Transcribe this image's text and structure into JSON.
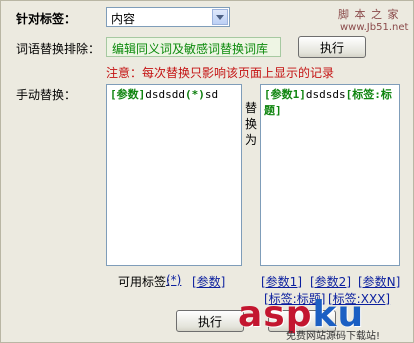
{
  "header": {
    "target_label": "针对标签：",
    "target_select_value": "内容"
  },
  "exclude": {
    "label": "词语替换排除：",
    "box_text": "编辑同义词及敏感词替换词库",
    "run_button": "执行",
    "notice": "注意：每次替换只影响该页面上显示的记录"
  },
  "manual": {
    "label": "手动替换：",
    "left_text_tag": "[参数]",
    "left_text_mid": "dsdsdd",
    "left_text_star": "(*)",
    "left_text_end": "sd",
    "right_text_tag1": "[参数1]",
    "right_text_mid": "dsdsds",
    "right_text_tag2": "[标签:标题]",
    "replace_as": [
      "替",
      "换",
      "为"
    ]
  },
  "available_tags": {
    "label": "可用标签:",
    "left_tags": [
      "(*)",
      "[参数]"
    ],
    "right_tags_row1": [
      "[参数1]",
      "[参数2]",
      "[参数N]"
    ],
    "right_tags_row2": [
      "[标签:标题]",
      "[标签:XXX]"
    ]
  },
  "footer": {
    "run_button": "执行"
  },
  "watermark": {
    "top_right_line1": "脚 本 之 家",
    "top_right_line2": "www.Jb51.net",
    "bottom_right_logo_a": "asp",
    "bottom_right_logo_b": "ku",
    "bottom_right_sub": "免费网站源码下载站!"
  }
}
